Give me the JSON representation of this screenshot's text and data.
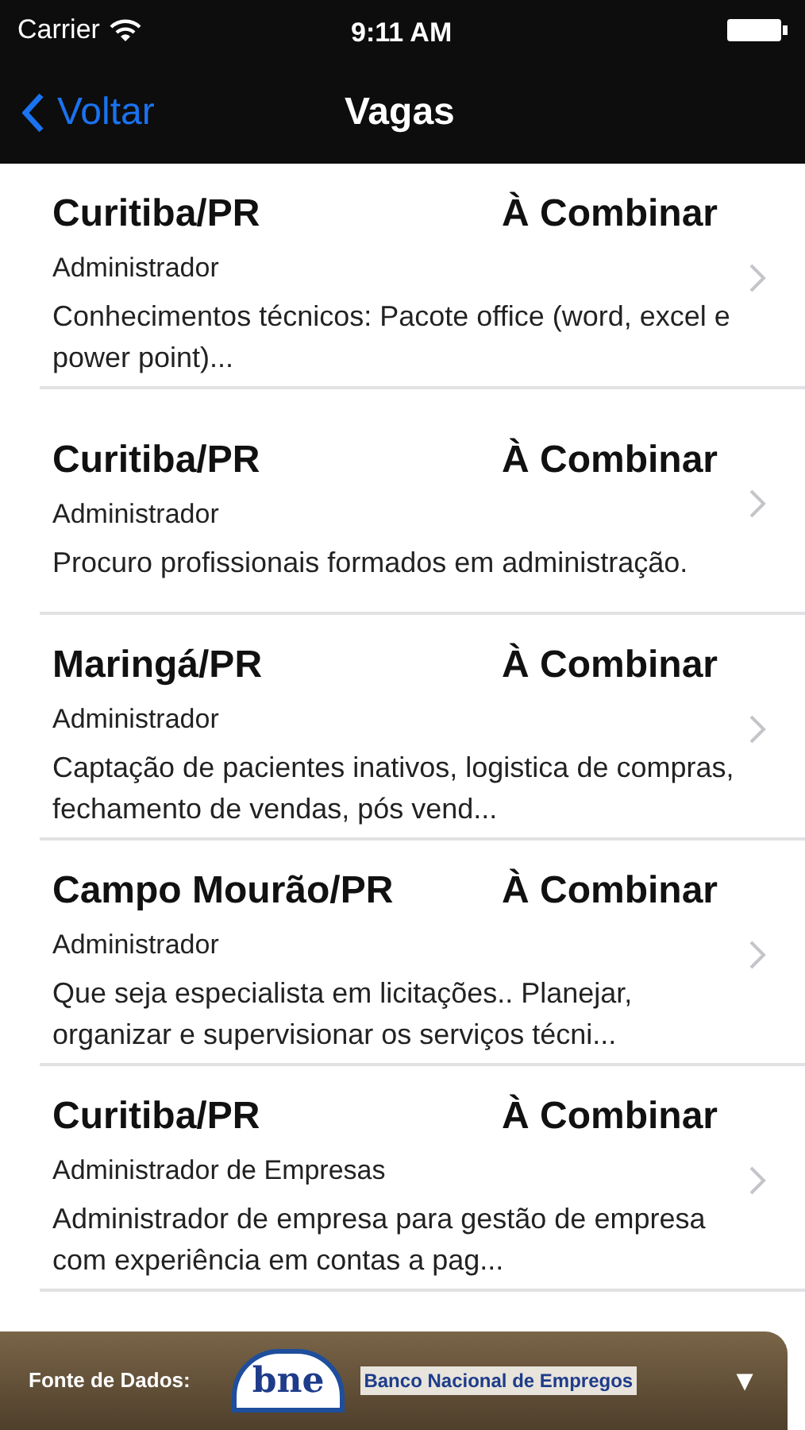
{
  "status_bar": {
    "carrier": "Carrier",
    "time": "9:11 AM"
  },
  "nav": {
    "back": "Voltar",
    "title": "Vagas"
  },
  "jobs": [
    {
      "city": "Curitiba/PR",
      "salary": "À Combinar",
      "role": "Administrador",
      "description": "Conhecimentos técnicos: Pacote office (word, excel e power point)..."
    },
    {
      "city": "Curitiba/PR",
      "salary": "À Combinar",
      "role": "Administrador",
      "description": "Procuro profissionais formados em administração."
    },
    {
      "city": "Maringá/PR",
      "salary": "À Combinar",
      "role": "Administrador",
      "description": "Captação de pacientes inativos, logistica de compras, fechamento de vendas, pós vend..."
    },
    {
      "city": "Campo Mourão/PR",
      "salary": "À Combinar",
      "role": "Administrador",
      "description": "Que seja especialista em licitações.. Planejar, organizar e supervisionar os serviços técni..."
    },
    {
      "city": "Curitiba/PR",
      "salary": "À Combinar",
      "role": "Administrador de Empresas",
      "description": "Administrador de empresa para gestão de empresa com experiência em contas a pag..."
    }
  ],
  "footer": {
    "label": "Fonte de Dados:",
    "logo": "bne",
    "source": "Banco Nacional de Empregos",
    "toggle": "▼"
  }
}
